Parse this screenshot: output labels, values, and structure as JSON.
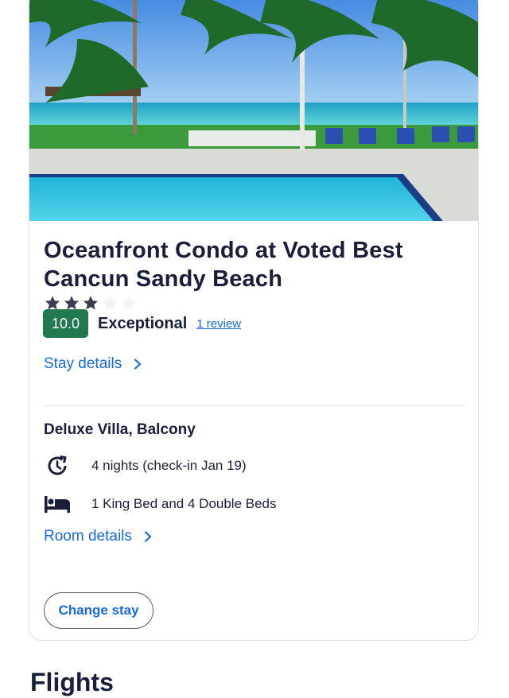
{
  "property": {
    "title": "Oceanfront Condo at Voted Best Cancun Sandy Beach",
    "star_rating": 3,
    "star_rating_max": 5,
    "score": "10.0",
    "rating_label": "Exceptional",
    "review_link": "1 review",
    "stay_details_link": "Stay details"
  },
  "room": {
    "name": "Deluxe Villa, Balcony",
    "nights": "4 nights (check-in Jan 19)",
    "beds": "1 King Bed and 4 Double Beds",
    "room_details_link": "Room details"
  },
  "actions": {
    "change_stay": "Change stay"
  },
  "next_section": {
    "heading": "Flights"
  },
  "colors": {
    "brand_blue": "#1668e3",
    "score_green": "#227950",
    "text_dark": "#191e3b",
    "divider": "#dfe0e4"
  },
  "icons": {
    "nights": "history-clock-icon",
    "beds": "bed-icon",
    "link_chevron": "chevron-right-icon",
    "star": "star-icon"
  }
}
